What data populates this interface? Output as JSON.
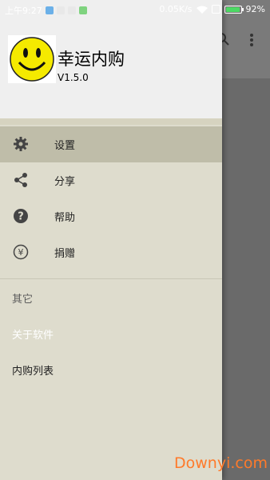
{
  "status_bar": {
    "time": "上午9:27",
    "speed": "0.05K/s",
    "battery": "92%",
    "battery_level": 0.92
  },
  "background_app": {
    "toolbar_icons": [
      "search-icon",
      "more-vert-icon"
    ]
  },
  "drawer": {
    "app_name": "幸运内购",
    "version": "V1.5.0",
    "menu": [
      {
        "label": "设置",
        "icon": "gear-icon",
        "active": true
      },
      {
        "label": "分享",
        "icon": "share-icon",
        "active": false
      },
      {
        "label": "帮助",
        "icon": "help-icon",
        "active": false
      },
      {
        "label": "捐赠",
        "icon": "donate-icon",
        "active": false
      }
    ],
    "sections": [
      {
        "label": "其它",
        "color": "#5a5a5a"
      },
      {
        "label": "关于软件",
        "color": "#ffffff"
      },
      {
        "label": "内购列表",
        "color": "#222222"
      }
    ]
  },
  "watermark": "Downyi.com",
  "colors": {
    "drawer_bg": "#dedccd",
    "active_item_bg": "#bfbda9",
    "battery_fill": "#4cd964",
    "watermark": "#ff7a2a"
  }
}
